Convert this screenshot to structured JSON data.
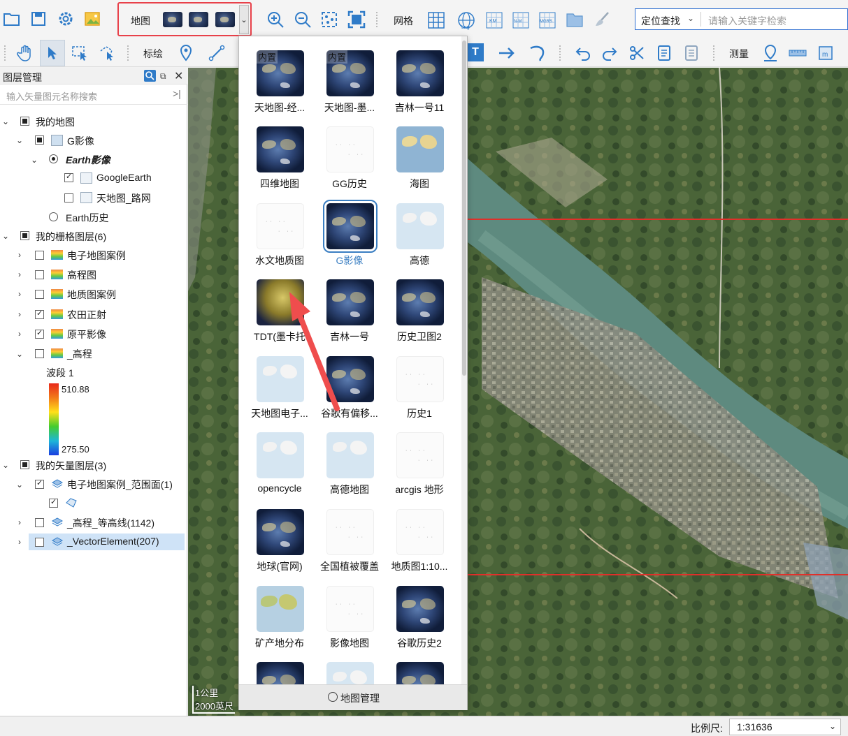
{
  "toolbar": {
    "map_label": "地图",
    "grid_label": "网格",
    "plot_label": "标绘",
    "measure_label": "测量",
    "locate_label": "定位查找",
    "search_placeholder": "请输入关键字检索",
    "small_labels": {
      "lng": "Lng",
      "km": "KM",
      "nm": "N-M",
      "mgrs": "MGRS"
    }
  },
  "layer_panel": {
    "title": "图层管理",
    "search_placeholder": "输入矢量图元名称搜索",
    "tree": {
      "my_map": "我的地图",
      "g_imagery": "G影像",
      "earth_imagery": "Earth影像",
      "google_earth": "GoogleEarth",
      "tdt_road": "天地图_路网",
      "earth_history": "Earth历史",
      "raster_group": "我的栅格图层(6)",
      "raster_items": [
        "电子地图案例",
        "高程图",
        "地质图案例",
        "农田正射",
        "原平影像",
        "_高程"
      ],
      "band_label": "波段 1",
      "band_max": "510.88",
      "band_min": "275.50",
      "vector_group": "我的矢量图层(3)",
      "vector_items": [
        "电子地图案例_范围面(1)",
        "_高程_等高线(1142)",
        "_VectorElement(207)"
      ]
    }
  },
  "basemap_dropdown": {
    "items": [
      {
        "name": "天地图-经...",
        "badge": "内置",
        "style": "dark"
      },
      {
        "name": "天地图-墨...",
        "badge": "内置",
        "style": "dark"
      },
      {
        "name": "吉林一号11",
        "badge": "",
        "style": "dark"
      },
      {
        "name": "四维地图",
        "badge": "",
        "style": "dark"
      },
      {
        "name": "GG历史",
        "badge": "",
        "style": "white"
      },
      {
        "name": "海图",
        "badge": "",
        "style": "sea"
      },
      {
        "name": "水文地质图",
        "badge": "",
        "style": "white"
      },
      {
        "name": "G影像",
        "badge": "",
        "style": "dark",
        "selected": true
      },
      {
        "name": "高德",
        "badge": "",
        "style": "light"
      },
      {
        "name": "TDT(墨卡托",
        "badge": "",
        "style": "tdt"
      },
      {
        "name": "吉林一号",
        "badge": "",
        "style": "dark"
      },
      {
        "name": "历史卫图2",
        "badge": "",
        "style": "dark"
      },
      {
        "name": "天地图电子...",
        "badge": "",
        "style": "light"
      },
      {
        "name": "谷歌有偏移...",
        "badge": "",
        "style": "dark"
      },
      {
        "name": "历史1",
        "badge": "",
        "style": "white"
      },
      {
        "name": "opencycle",
        "badge": "",
        "style": "light"
      },
      {
        "name": "高德地图",
        "badge": "",
        "style": "light"
      },
      {
        "name": "arcgis 地形",
        "badge": "",
        "style": "white"
      },
      {
        "name": "地球(官网)",
        "badge": "",
        "style": "dark"
      },
      {
        "name": "全国植被覆盖",
        "badge": "",
        "style": "white"
      },
      {
        "name": "地质图1:10...",
        "badge": "",
        "style": "white"
      },
      {
        "name": "矿产地分布",
        "badge": "",
        "style": "mineral"
      },
      {
        "name": "影像地图",
        "badge": "",
        "style": "white"
      },
      {
        "name": "谷歌历史2",
        "badge": "",
        "style": "dark"
      },
      {
        "name": "",
        "badge": "",
        "style": "dark"
      },
      {
        "name": "",
        "badge": "",
        "style": "light"
      },
      {
        "name": "",
        "badge": "",
        "style": "dark"
      }
    ],
    "footer_label": "地图管理"
  },
  "map": {
    "scale_top": "1公里",
    "scale_bottom": "2000英尺"
  },
  "statusbar": {
    "scale_label": "比例尺:",
    "scale_value": "1:31636"
  },
  "colors": {
    "highlight": "#e8414a",
    "selection": "#3a7ec2",
    "annotation_arrow": "#ef4d4d",
    "grid_line": "#e0302a"
  }
}
